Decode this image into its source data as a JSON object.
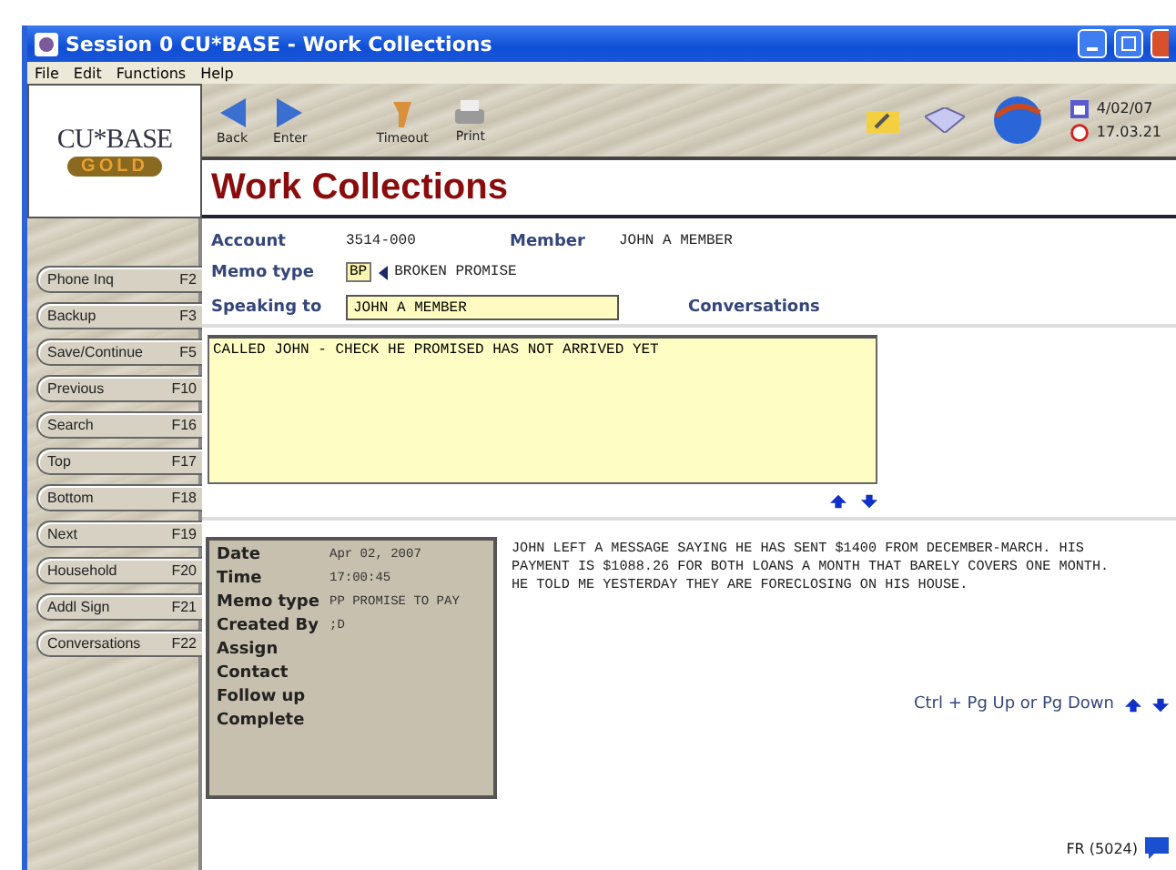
{
  "window": {
    "title": "Session 0 CU*BASE - Work Collections"
  },
  "menu": [
    "File",
    "Edit",
    "Functions",
    "Help"
  ],
  "logo": {
    "name": "CU*BASE",
    "edition": "GOLD"
  },
  "toolbar": [
    {
      "label": "Back",
      "kind": "back"
    },
    {
      "label": "Enter",
      "kind": "enter"
    },
    {
      "label": "Timeout",
      "kind": "timeout"
    },
    {
      "label": "Print",
      "kind": "print"
    }
  ],
  "status": {
    "date": "4/02/07",
    "time": "17.03.21"
  },
  "page_title": "Work Collections",
  "sidebar": [
    {
      "label": "Phone Inq",
      "key": "F2"
    },
    {
      "label": "Backup",
      "key": "F3"
    },
    {
      "label": "Save/Continue",
      "key": "F5"
    },
    {
      "label": "Previous",
      "key": "F10"
    },
    {
      "label": "Search",
      "key": "F16"
    },
    {
      "label": "Top",
      "key": "F17"
    },
    {
      "label": "Bottom",
      "key": "F18"
    },
    {
      "label": "Next",
      "key": "F19"
    },
    {
      "label": "Household",
      "key": "F20"
    },
    {
      "label": "Addl Sign",
      "key": "F21"
    },
    {
      "label": "Conversations",
      "key": "F22"
    }
  ],
  "form": {
    "account_label": "Account",
    "account": "3514-000",
    "member_label": "Member",
    "member": "JOHN A MEMBER",
    "memo_type_label": "Memo type",
    "memo_code": "BP",
    "memo_desc": "BROKEN PROMISE",
    "speaking_label": "Speaking to",
    "speaking_to": "JOHN A MEMBER",
    "conversations_label": "Conversations"
  },
  "memo_text": "CALLED JOHN - CHECK HE PROMISED HAS NOT ARRIVED YET",
  "details": [
    {
      "label": "Date",
      "value": "Apr 02, 2007"
    },
    {
      "label": "Time",
      "value": "17:00:45"
    },
    {
      "label": "Memo type",
      "value": "PP PROMISE TO PAY"
    },
    {
      "label": "Created By",
      "value": ";D"
    },
    {
      "label": "Assign"
    },
    {
      "label": "Contact"
    },
    {
      "label": "Follow up"
    },
    {
      "label": "Complete"
    }
  ],
  "note": "JOHN LEFT A MESSAGE SAYING HE HAS SENT $1400 FROM DECEMBER-MARCH. HIS\nPAYMENT IS $1088.26 FOR BOTH LOANS A MONTH THAT BARELY COVERS ONE MONTH.\nHE TOLD ME YESTERDAY THEY ARE FORECLOSING ON HIS HOUSE.",
  "nav_hint": "Ctrl + Pg Up or Pg Down",
  "screen_id": "FR (5024)"
}
